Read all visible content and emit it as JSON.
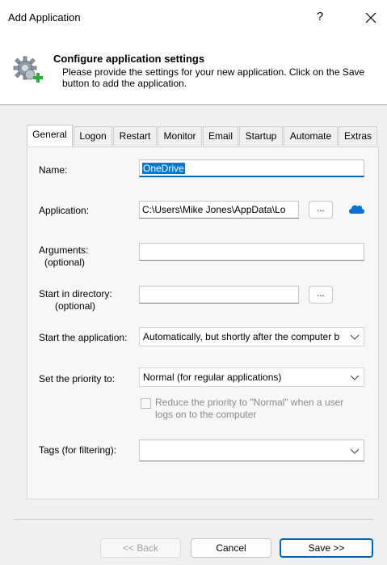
{
  "window": {
    "title": "Add Application",
    "help_label": "?",
    "close_icon": "close-icon"
  },
  "header": {
    "title": "Configure application settings",
    "description": "Please provide the settings for your new application. Click on the Save button to add the application.",
    "icon": "gear-add-icon"
  },
  "tabs": [
    {
      "label": "General",
      "active": true
    },
    {
      "label": "Logon"
    },
    {
      "label": "Restart"
    },
    {
      "label": "Monitor"
    },
    {
      "label": "Email"
    },
    {
      "label": "Startup"
    },
    {
      "label": "Automate"
    },
    {
      "label": "Extras"
    }
  ],
  "form": {
    "name": {
      "label": "Name:",
      "value": "OneDrive"
    },
    "application": {
      "label": "Application:",
      "value": "C:\\Users\\Mike Jones\\AppData\\Lo",
      "browse_label": "...",
      "icon": "onedrive-cloud-icon"
    },
    "arguments": {
      "label": "Arguments:",
      "sublabel": "(optional)",
      "value": ""
    },
    "start_dir": {
      "label": "Start in directory:",
      "sublabel": "(optional)",
      "value": "",
      "browse_label": "..."
    },
    "start_app": {
      "label": "Start the application:",
      "value": "Automatically, but shortly after the computer b"
    },
    "priority": {
      "label": "Set the priority to:",
      "value": "Normal (for regular applications)"
    },
    "reduce_priority": {
      "label_line1": "Reduce the priority to \"Normal\" when a user",
      "label_line2": "logs on to the computer",
      "checked": false
    },
    "tags": {
      "label": "Tags (for filtering):",
      "value": ""
    }
  },
  "footer": {
    "back_label": "<< Back",
    "cancel_label": "Cancel",
    "save_label": "Save >>"
  },
  "colors": {
    "accent": "#0067c0",
    "selection": "#0078d7",
    "onedrive": "#0a74d6"
  }
}
